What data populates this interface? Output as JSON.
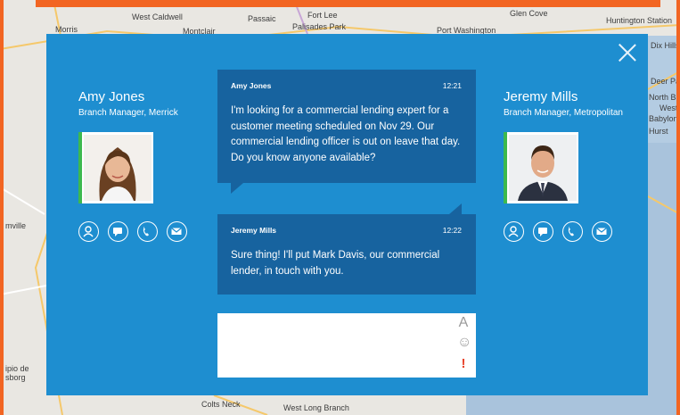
{
  "map": {
    "towns": [
      "West Caldwell",
      "Morris",
      "Montclair",
      "Passaic",
      "Fort Lee",
      "Palisades Park",
      "Port Washington",
      "Glen Cove",
      "Huntington Station",
      "Dix Hills",
      "Deer Park",
      "North Babylon",
      "West",
      "Babylon",
      "Hurst",
      "mville",
      "ipio de",
      "sborg",
      "Colts Neck",
      "West Long Branch"
    ]
  },
  "left_person": {
    "name": "Amy Jones",
    "role": "Branch Manager, Merrick"
  },
  "right_person": {
    "name": "Jeremy Mills",
    "role": "Branch Manager, Metropolitan"
  },
  "messages": [
    {
      "sender": "Amy Jones",
      "time": "12:21",
      "text": "I'm looking for a commercial lending expert for a customer meeting scheduled on Nov 29. Our commercial lending officer is out on leave that day. Do you know anyone available?"
    },
    {
      "sender": "Jeremy Mills",
      "time": "12:22",
      "text": "Sure thing! I'll put Mark Davis, our commercial lender, in touch with you."
    }
  ],
  "composer": {
    "value": "",
    "font_tool": "A",
    "emoji_tool": "☺",
    "priority_tool": "!"
  },
  "actions": [
    "profile-icon",
    "chat-icon",
    "phone-icon",
    "email-icon"
  ],
  "colors": {
    "dialog": "#1e8ed0",
    "bubble": "#17639f",
    "frame": "#f26522",
    "presence": "#3db94e",
    "priority": "#e8442c"
  }
}
